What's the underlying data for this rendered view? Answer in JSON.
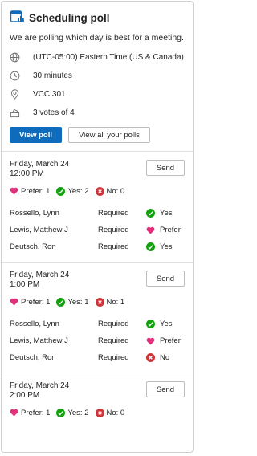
{
  "card": {
    "title": "Scheduling poll",
    "description": "We are polling which day is best for a meeting.",
    "info": [
      {
        "icon": "globe-icon",
        "text": "(UTC-05:00) Eastern Time (US & Canada)"
      },
      {
        "icon": "clock-icon",
        "text": "30 minutes"
      },
      {
        "icon": "location-icon",
        "text": "VCC 301"
      },
      {
        "icon": "ballot-icon",
        "text": "3 votes of 4"
      }
    ],
    "buttons": {
      "view_poll": "View poll",
      "view_all": "View all your polls"
    }
  },
  "colors": {
    "primary": "#0f6cbd",
    "prefer": "#e3307c",
    "yes": "#13a10e",
    "no": "#d13438"
  },
  "send_label": "Send",
  "slots": [
    {
      "date": "Friday, March 24",
      "time": "12:00 PM",
      "prefer": "Prefer: 1",
      "yes": "Yes: 2",
      "no": "No: 0",
      "responses": [
        {
          "name": "Rossello, Lynn",
          "role": "Required",
          "status": "Yes"
        },
        {
          "name": "Lewis, Matthew J",
          "role": "Required",
          "status": "Prefer"
        },
        {
          "name": "Deutsch, Ron",
          "role": "Required",
          "status": "Yes"
        }
      ]
    },
    {
      "date": "Friday, March 24",
      "time": "1:00 PM",
      "prefer": "Prefer: 1",
      "yes": "Yes: 1",
      "no": "No: 1",
      "responses": [
        {
          "name": "Rossello, Lynn",
          "role": "Required",
          "status": "Yes"
        },
        {
          "name": "Lewis, Matthew J",
          "role": "Required",
          "status": "Prefer"
        },
        {
          "name": "Deutsch, Ron",
          "role": "Required",
          "status": "No"
        }
      ]
    },
    {
      "date": "Friday, March 24",
      "time": "2:00 PM",
      "prefer": "Prefer: 1",
      "yes": "Yes: 2",
      "no": "No: 0",
      "responses": []
    }
  ]
}
